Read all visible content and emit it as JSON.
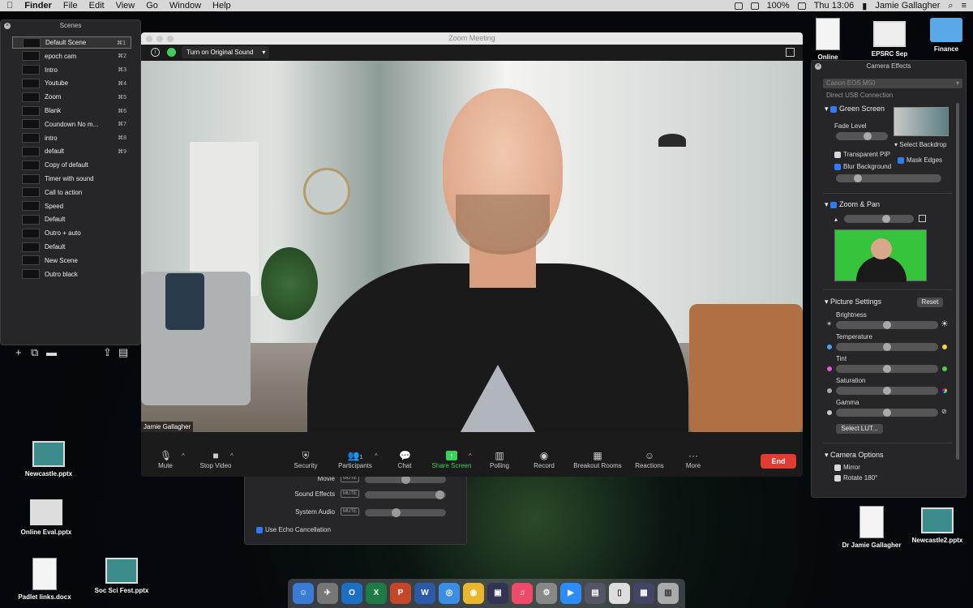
{
  "menubar": {
    "app": "Finder",
    "items": [
      "File",
      "Edit",
      "View",
      "Go",
      "Window",
      "Help"
    ],
    "battery": "100%",
    "clock": "Thu 13:06",
    "user": "Jamie Gallagher"
  },
  "scenes": {
    "title": "Scenes",
    "items": [
      {
        "label": "Default Scene",
        "key": "⌘1"
      },
      {
        "label": "epoch cam",
        "key": "⌘2"
      },
      {
        "label": "Intro",
        "key": "⌘3"
      },
      {
        "label": "Youtube",
        "key": "⌘4"
      },
      {
        "label": "Zoom",
        "key": "⌘5"
      },
      {
        "label": "Blank",
        "key": "⌘6"
      },
      {
        "label": "Coundown No m...",
        "key": "⌘7"
      },
      {
        "label": "intro",
        "key": "⌘8"
      },
      {
        "label": "default",
        "key": "⌘9"
      },
      {
        "label": "Copy of default",
        "key": ""
      },
      {
        "label": "Timer with sound",
        "key": ""
      },
      {
        "label": "Call to action",
        "key": ""
      },
      {
        "label": "Speed",
        "key": ""
      },
      {
        "label": "Default",
        "key": ""
      },
      {
        "label": "Outro + auto",
        "key": ""
      },
      {
        "label": "Default",
        "key": ""
      },
      {
        "label": "New Scene",
        "key": ""
      },
      {
        "label": "Outro black",
        "key": ""
      }
    ]
  },
  "zoom": {
    "title": "Zoom Meeting",
    "original_sound": "Turn on Original Sound",
    "participant_name": "Jamie Gallagher",
    "participant_count": "1",
    "controls": {
      "mute": "Mute",
      "video": "Stop Video",
      "security": "Security",
      "participants": "Participants",
      "chat": "Chat",
      "share": "Share Screen",
      "polling": "Polling",
      "record": "Record",
      "breakout": "Breakout Rooms",
      "reactions": "Reactions",
      "more": "More",
      "end": "End"
    }
  },
  "audio": {
    "rows": [
      {
        "label": "Movie",
        "level": 0.5
      },
      {
        "label": "Sound Effects",
        "level": 0.95
      },
      {
        "label": "System Audio",
        "level": 0.38
      }
    ],
    "mute": "MUTE",
    "echo": "Use Echo Cancellation"
  },
  "camfx": {
    "title": "Camera Effects",
    "camera": "Canon EOS M50",
    "connection": "Direct USB Connection",
    "green_screen": "Green Screen",
    "fade_level": "Fade Level",
    "select_backdrop": "▾ Select Backdrop",
    "transparent_pip": "Transparent PIP",
    "mask_edges": "Mask Edges",
    "blur_bg": "Blur Background",
    "zoom_pan": "Zoom & Pan",
    "picture_settings": "Picture Settings",
    "reset": "Reset",
    "brightness": "Brightness",
    "temperature": "Temperature",
    "tint": "Tint",
    "saturation": "Saturation",
    "gamma": "Gamma",
    "select_lut": "Select LUT...",
    "camera_options": "Camera Options",
    "mirror": "Mirror",
    "rotate": "Rotate 180°"
  },
  "desktop": {
    "files": [
      "Online",
      "EPSRC Sep",
      "Finance",
      "Newcastle.pptx",
      "Online Eval.pptx",
      "Padlet links.docx",
      "Soc Sci Fest.pptx",
      "Dr Jamie Gallagher",
      "Newcastle2.pptx"
    ]
  }
}
